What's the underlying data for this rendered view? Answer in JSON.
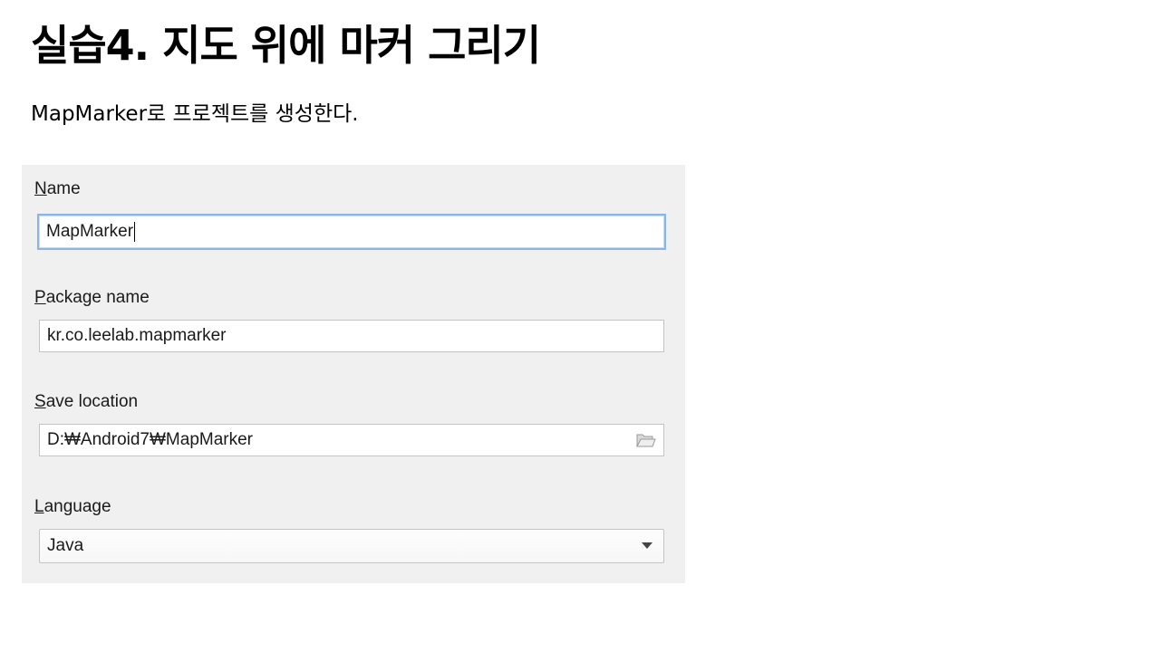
{
  "slide": {
    "title": "실습4. 지도 위에 마커 그리기",
    "subtitle": "MapMarker로 프로젝트를 생성한다."
  },
  "dialog": {
    "name": {
      "label_mnemonic": "N",
      "label_rest": "ame",
      "value": "MapMarker"
    },
    "package": {
      "label_mnemonic": "P",
      "label_rest": "ackage name",
      "value": "kr.co.leelab.mapmarker"
    },
    "save_location": {
      "label_mnemonic": "S",
      "label_rest": "ave location",
      "value": "D:₩Android7₩MapMarker",
      "browse_icon": "folder-open-icon"
    },
    "language": {
      "label_mnemonic": "L",
      "label_rest": "anguage",
      "selected": "Java",
      "dropdown_icon": "chevron-down-icon"
    }
  },
  "colors": {
    "dialog_background": "#f0f0f0",
    "focus_border": "#8ab6e6",
    "field_border": "#c4c4c4"
  }
}
